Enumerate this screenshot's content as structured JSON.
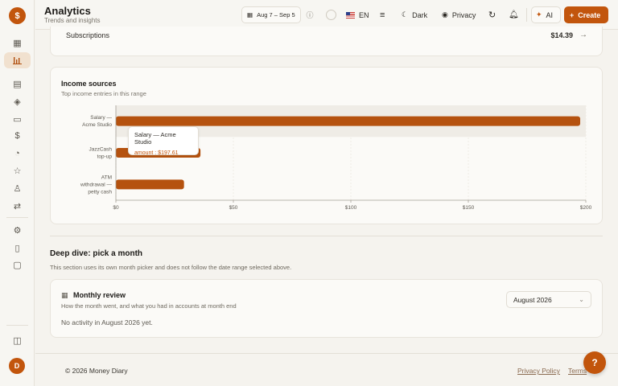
{
  "app": {
    "logo_symbol": "$",
    "brand_color": "#c2550c"
  },
  "header": {
    "title": "Analytics",
    "subtitle": "Trends and insights",
    "date_range": "Aug 7 – Sep 5",
    "language": "EN",
    "theme_label": "Dark",
    "privacy_label": "Privacy",
    "ai_label": "AI",
    "create_label": "Create"
  },
  "sidebar": {
    "items": [
      {
        "name": "dashboard-icon",
        "glyph": "▦"
      },
      {
        "name": "analytics-icon",
        "glyph": "📊"
      },
      {
        "name": "reports-icon",
        "glyph": "▤"
      },
      {
        "name": "tags-icon",
        "glyph": "◈"
      },
      {
        "name": "accounts-icon",
        "glyph": "▭"
      },
      {
        "name": "currency-icon",
        "glyph": "$"
      },
      {
        "name": "budget-icon",
        "glyph": "◔"
      },
      {
        "name": "goals-icon",
        "glyph": "☆"
      },
      {
        "name": "contacts-icon",
        "glyph": "♙"
      },
      {
        "name": "transfers-icon",
        "glyph": "⇄"
      },
      {
        "name": "settings-icon",
        "glyph": "⚙"
      },
      {
        "name": "documents-icon",
        "glyph": "▯"
      },
      {
        "name": "feedback-icon",
        "glyph": "▢"
      }
    ],
    "collapse_glyph": "◫",
    "avatar_initial": "D"
  },
  "subscriptions": {
    "label": "Subscriptions",
    "value": "$14.39"
  },
  "income": {
    "title": "Income sources",
    "subtitle": "Top income entries in this range",
    "tooltip": {
      "title": "Salary — Acme Studio",
      "value": "amount : $197.61"
    }
  },
  "chart_data": {
    "type": "bar",
    "orientation": "horizontal",
    "categories": [
      "Salary — Acme Studio",
      "JazzCash top-up",
      "ATM withdrawal — petty cash"
    ],
    "category_lines": [
      [
        "Salary —",
        "Acme Studio"
      ],
      [
        "JazzCash",
        "top-up"
      ],
      [
        "ATM",
        "withdrawal —",
        "petty cash"
      ]
    ],
    "values": [
      197.61,
      36,
      29
    ],
    "xlim": [
      0,
      200
    ],
    "x_ticks": [
      "$0",
      "$50",
      "$100",
      "$150",
      "$200"
    ],
    "bar_color": "#b5520f",
    "grid": true,
    "highlighted_index": 0
  },
  "deep_dive": {
    "title": "Deep dive: pick a month",
    "subtitle": "This section uses its own month picker and does not follow the date range selected above."
  },
  "monthly": {
    "title": "Monthly review",
    "subtitle": "How the month went, and what you had in accounts at month end",
    "selected_month": "August 2026",
    "empty_text": "No activity in August 2026 yet."
  },
  "footer": {
    "copyright": "© 2026 Money Diary",
    "privacy_link": "Privacy Policy",
    "terms_link": "Terms",
    "help_glyph": "?"
  }
}
